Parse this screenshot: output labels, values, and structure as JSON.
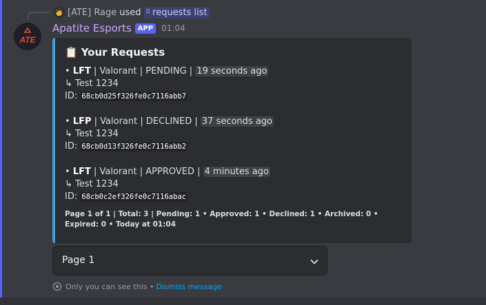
{
  "reply": {
    "avatar_emoji": "🧑",
    "user": "[ATE] Rage",
    "used_label": "used",
    "command_icon": "⠿",
    "command": "requests list"
  },
  "message": {
    "bot_name": "Apatite Esports",
    "badge": "APP",
    "time": "01:04",
    "avatar_icon": "apatite-logo-icon",
    "avatar_text": "ATE"
  },
  "embed": {
    "accent_color": "#3a9fe0",
    "title_icon": "📋",
    "title": "Your Requests",
    "requests": [
      {
        "bullet": "•",
        "type": "LFT",
        "game": "Valorant",
        "status": "PENDING",
        "age": "19 seconds ago",
        "sub_arrow": "↳",
        "text": "Test 1234",
        "id_label": "ID:",
        "id": "68cb0d25f326fe0c7116abb7"
      },
      {
        "bullet": "•",
        "type": "LFP",
        "game": "Valorant",
        "status": "DECLINED",
        "age": "37 seconds ago",
        "sub_arrow": "↳",
        "text": "Test 1234",
        "id_label": "ID:",
        "id": "68cb0d13f326fe0c7116abb2"
      },
      {
        "bullet": "•",
        "type": "LFT",
        "game": "Valorant",
        "status": "APPROVED",
        "age": "4 minutes ago",
        "sub_arrow": "↳",
        "text": "Test 1234",
        "id_label": "ID:",
        "id": "68cb0c2ef326fe0c7116abac"
      }
    ],
    "footer": "Page 1 of 1 | Total: 3 | Pending: 1 • Approved: 1 • Declined: 1 • Archived: 0 • Expired: 0  • Today at 01:04"
  },
  "select": {
    "value": "Page 1",
    "icon": "chevron-down-icon"
  },
  "ephemeral": {
    "icon": "eye-icon",
    "text": "Only you can see this •",
    "dismiss": "Dismiss message"
  }
}
